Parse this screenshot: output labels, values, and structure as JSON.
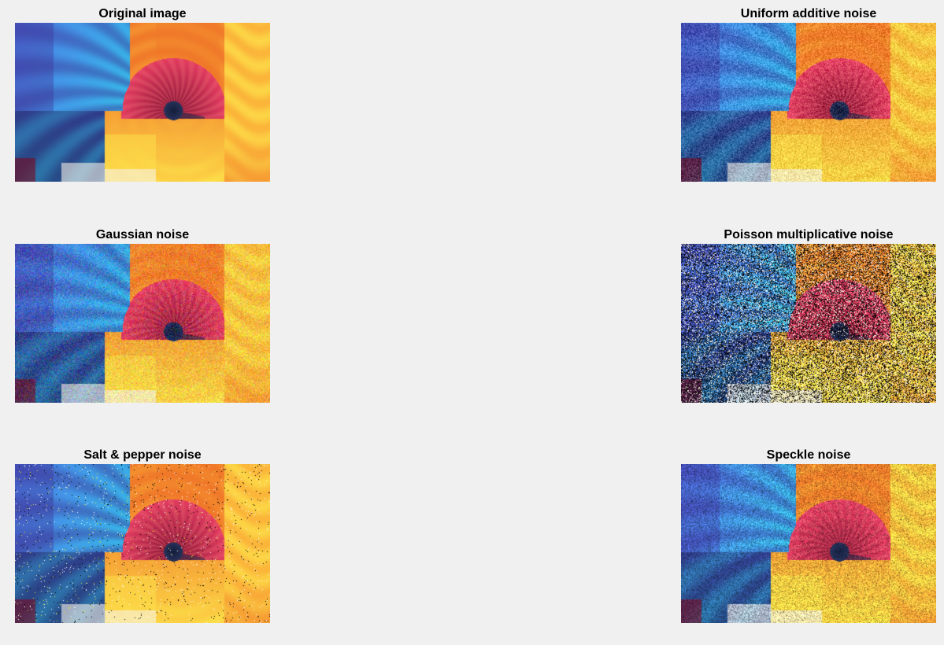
{
  "figure": {
    "background": "#f0f0f0",
    "panels": [
      {
        "title": "Original image",
        "noise": "none",
        "palette": [
          "#3b2a8e",
          "#4d7ee8",
          "#33c0e8",
          "#e43b60",
          "#f07a2a",
          "#fbb53a",
          "#fde24a",
          "#f7f1e8"
        ]
      },
      {
        "title": "Uniform additive noise",
        "noise": "uniform",
        "palette": [
          "#3b2a8e",
          "#4d7ee8",
          "#33c0e8",
          "#e43b60",
          "#f07a2a",
          "#fbb53a",
          "#fde24a",
          "#f7f1e8"
        ]
      },
      {
        "title": "Gaussian noise",
        "noise": "gaussian",
        "palette": [
          "#3b2a8e",
          "#4d7ee8",
          "#33c0e8",
          "#e43b60",
          "#f07a2a",
          "#fbb53a",
          "#fde24a",
          "#f7f1e8"
        ]
      },
      {
        "title": "Poisson multiplicative noise",
        "noise": "poisson",
        "palette": [
          "#3b2a8e",
          "#4d7ee8",
          "#33c0e8",
          "#e43b60",
          "#f07a2a",
          "#fbb53a",
          "#fde24a",
          "#f7f1e8"
        ]
      },
      {
        "title": "Salt & pepper noise",
        "noise": "salt-pepper",
        "palette": [
          "#3b2a8e",
          "#4d7ee8",
          "#33c0e8",
          "#e43b60",
          "#f07a2a",
          "#fbb53a",
          "#fde24a",
          "#f7f1e8"
        ]
      },
      {
        "title": "Speckle noise",
        "noise": "speckle",
        "palette": [
          "#3b2a8e",
          "#4d7ee8",
          "#33c0e8",
          "#e43b60",
          "#f07a2a",
          "#fbb53a",
          "#fde24a",
          "#f7f1e8"
        ]
      }
    ]
  }
}
